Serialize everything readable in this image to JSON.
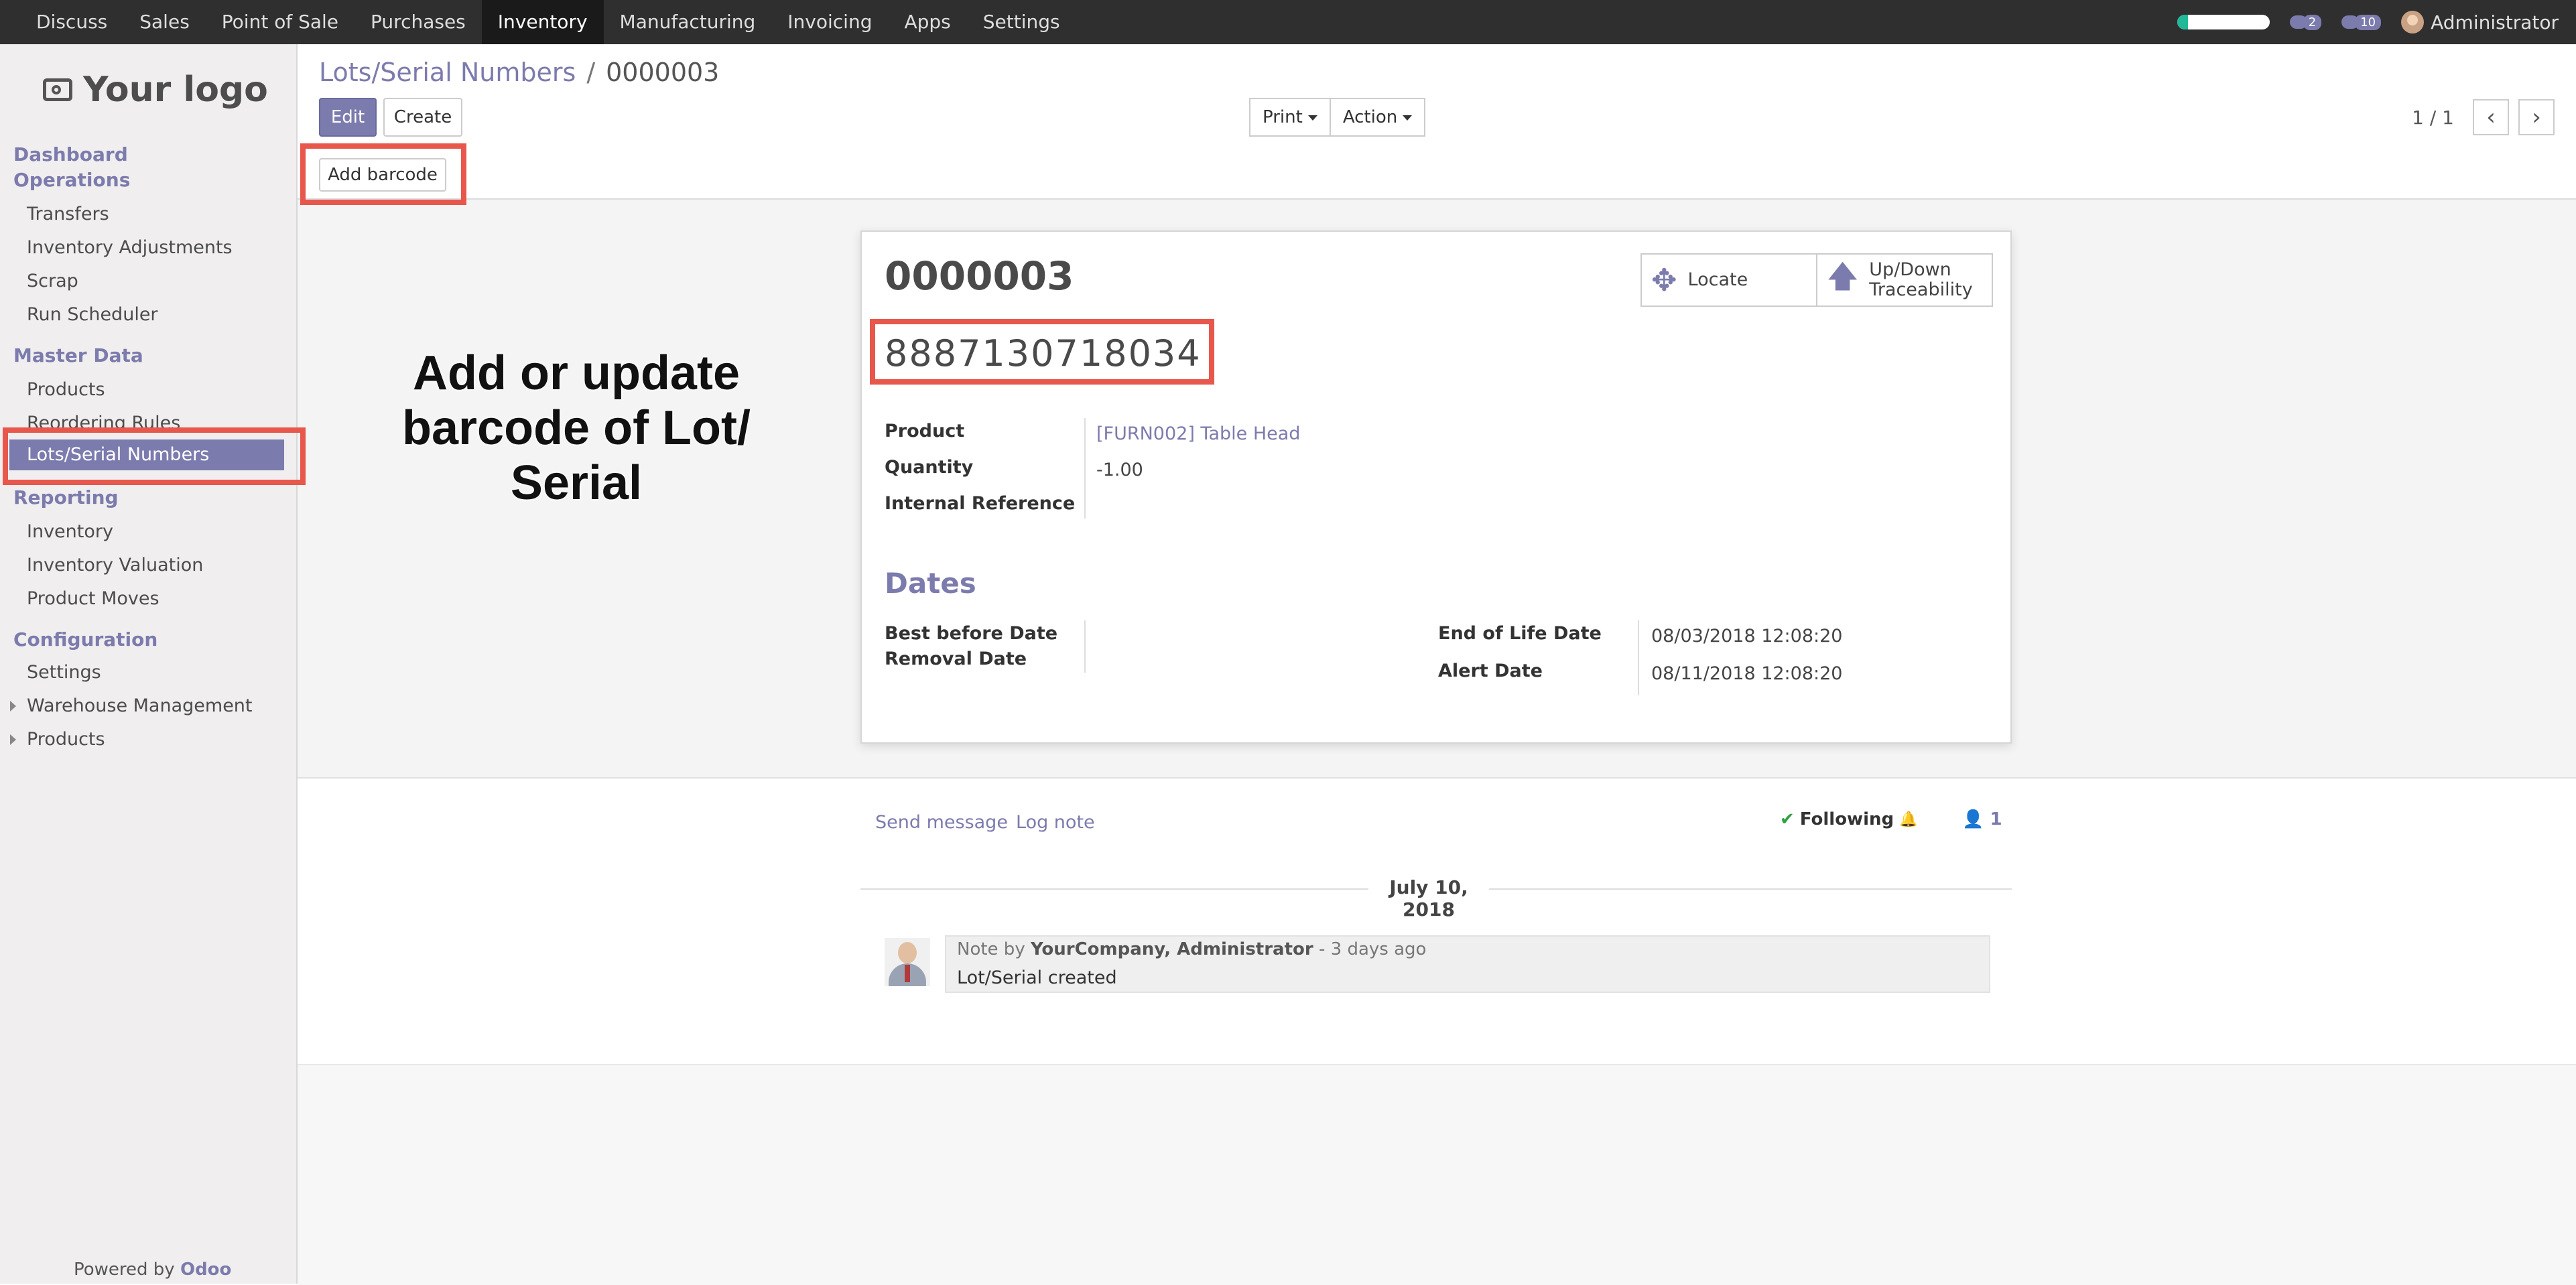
{
  "topbar": {
    "menu": [
      "Discuss",
      "Sales",
      "Point of Sale",
      "Purchases",
      "Inventory",
      "Manufacturing",
      "Invoicing",
      "Apps",
      "Settings"
    ],
    "active_menu": "Inventory",
    "system_progress": 0.12,
    "messages_count": "2",
    "activities_count": "10",
    "user": "Administrator"
  },
  "sidebar": {
    "logo_text": "Your logo",
    "sections": [
      {
        "title": "Dashboard",
        "subtitle": "Operations",
        "items": [
          "Transfers",
          "Inventory Adjustments",
          "Scrap",
          "Run Scheduler"
        ]
      },
      {
        "title": "Master Data",
        "items": [
          "Products",
          "Reordering Rules",
          "Lots/Serial Numbers"
        ]
      },
      {
        "title": "Reporting",
        "items": [
          "Inventory",
          "Inventory Valuation",
          "Product Moves"
        ]
      },
      {
        "title": "Configuration",
        "items": [
          "Settings",
          "Warehouse Management",
          "Products"
        ]
      }
    ],
    "powered_by": "Powered by",
    "powered_brand": "Odoo"
  },
  "control_panel": {
    "breadcrumb_parent": "Lots/Serial Numbers",
    "breadcrumb_sep": "/",
    "breadcrumb_current": "0000003",
    "edit_label": "Edit",
    "create_label": "Create",
    "print_label": "Print",
    "action_label": "Action",
    "pager_value": "1 / 1"
  },
  "statusbar": {
    "add_barcode_label": "Add barcode"
  },
  "form": {
    "name": "0000003",
    "barcode": "8887130718034",
    "buttons": {
      "locate": "Locate",
      "traceability_1": "Up/Down",
      "traceability_2": "Traceability"
    },
    "fields": {
      "product_label": "Product",
      "product_value": "[FURN002] Table Head",
      "quantity_label": "Quantity",
      "quantity_value": "-1.00",
      "internal_ref_label": "Internal Reference",
      "internal_ref_value": ""
    },
    "dates_title": "Dates",
    "dates": {
      "best_before_label": "Best before Date",
      "removal_label": "Removal Date",
      "end_of_life_label": "End of Life Date",
      "end_of_life_value": "08/03/2018 12:08:20",
      "alert_label": "Alert Date",
      "alert_value": "08/11/2018 12:08:20"
    }
  },
  "chatter": {
    "send_message": "Send message",
    "log_note": "Log note",
    "following": "Following",
    "followers_count": "1",
    "date_separator": "July 10, 2018",
    "message": {
      "prefix": "Note by",
      "author": "YourCompany, Administrator",
      "time": "- 3 days ago",
      "body": "Lot/Serial created"
    }
  },
  "annotation": {
    "line1": "Add or update",
    "line2": "barcode of Lot/",
    "line3": "Serial"
  },
  "colors": {
    "brand": "#7c7bad",
    "highlight": "#e8574c",
    "navbar": "#2f2f2f"
  }
}
